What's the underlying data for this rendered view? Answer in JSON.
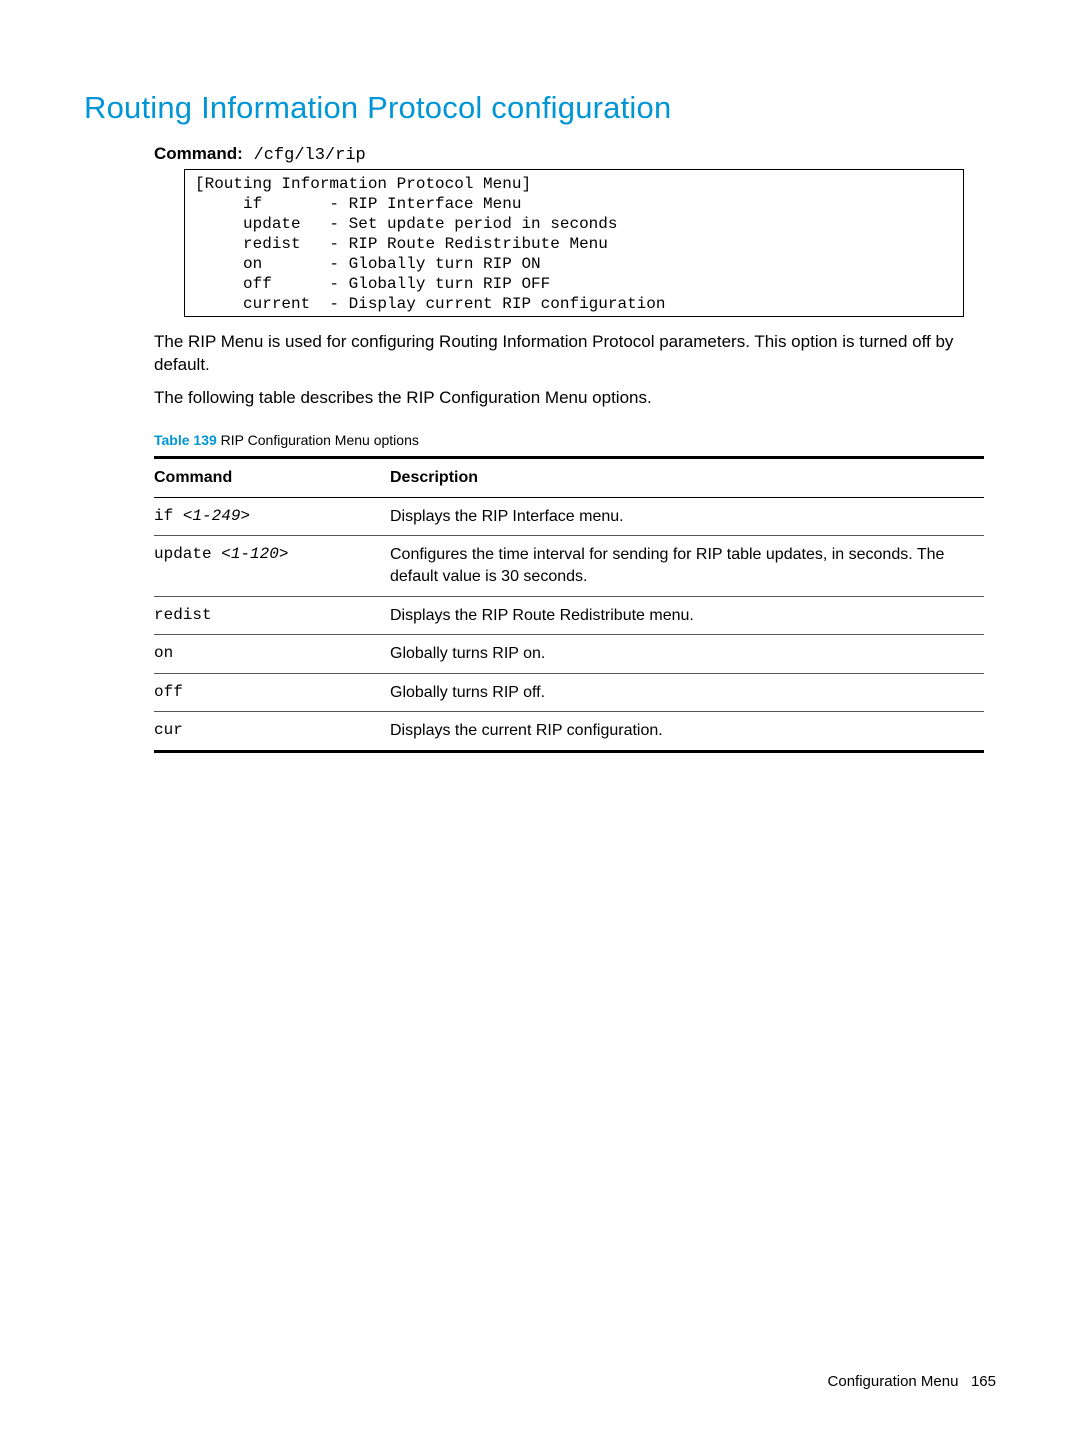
{
  "title": "Routing Information Protocol configuration",
  "command": {
    "label": "Command:",
    "value": "/cfg/l3/rip"
  },
  "menu_box": "[Routing Information Protocol Menu]\n     if       - RIP Interface Menu\n     update   - Set update period in seconds\n     redist   - RIP Route Redistribute Menu\n     on       - Globally turn RIP ON\n     off      - Globally turn RIP OFF\n     current  - Display current RIP configuration",
  "para1": "The RIP Menu is used for configuring Routing Information Protocol parameters. This option is turned off by default.",
  "para2": "The following table describes the RIP Configuration Menu options.",
  "table": {
    "caption_num": "Table 139",
    "caption_text": "  RIP Configuration Menu options",
    "headers": {
      "c1": "Command",
      "c2": "Description"
    },
    "rows": [
      {
        "cmd": "if ",
        "arg": "<1-249>",
        "desc": "Displays the RIP Interface menu."
      },
      {
        "cmd": "update ",
        "arg": "<1-120>",
        "desc": "Configures the time interval for sending for RIP table updates, in seconds. The default value is 30 seconds."
      },
      {
        "cmd": "redist",
        "arg": "",
        "desc": "Displays the RIP Route Redistribute menu."
      },
      {
        "cmd": "on",
        "arg": "",
        "desc": "Globally turns RIP on."
      },
      {
        "cmd": "off",
        "arg": "",
        "desc": "Globally turns RIP off."
      },
      {
        "cmd": "cur",
        "arg": "",
        "desc": "Displays the current RIP configuration."
      }
    ]
  },
  "footer": {
    "section": "Configuration Menu",
    "page": "165"
  }
}
